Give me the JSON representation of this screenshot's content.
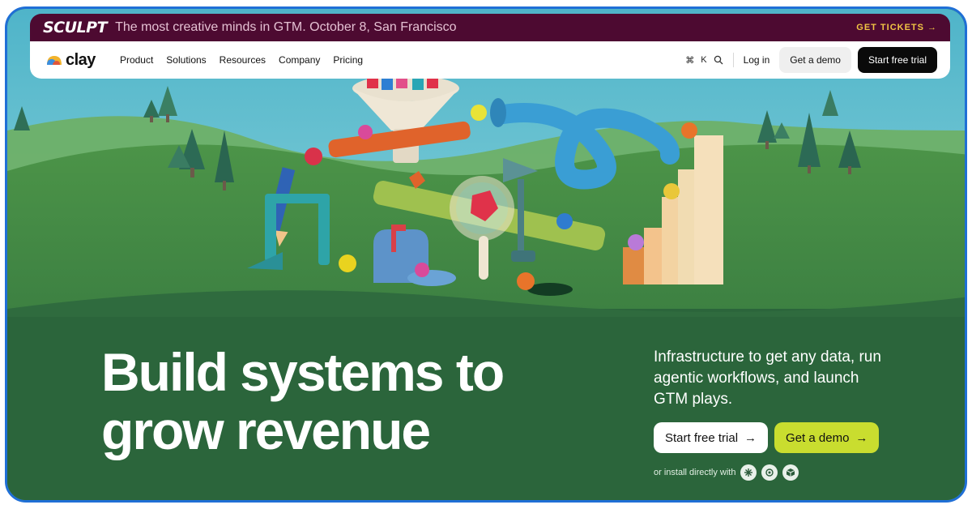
{
  "announcement": {
    "logo_text": "SCULPT",
    "text": "The most creative minds in GTM. October 8, San Francisco",
    "cta": "GET TICKETS",
    "cta_icon": "arrow-right-icon"
  },
  "nav": {
    "brand": "clay",
    "links": [
      "Product",
      "Solutions",
      "Resources",
      "Company",
      "Pricing"
    ],
    "shortcut_cmd": "⌘",
    "shortcut_key": "K",
    "search_icon": "search-icon",
    "login": "Log in",
    "demo": "Get a demo",
    "trial": "Start free trial"
  },
  "hero": {
    "headline_line1": "Build systems to",
    "headline_line2": "grow revenue",
    "subcopy": "Infrastructure to get any data, run agentic workflows, and launch GTM plays.",
    "trial_button": "Start free trial",
    "demo_button": "Get a demo",
    "install_text": "or install directly with",
    "install_icons": [
      "asterisk-icon",
      "openai-icon",
      "cube-icon"
    ]
  },
  "colors": {
    "announce_bg": "#4d0a31",
    "accent_yellow": "#f1c544",
    "demo_green": "#c9dd2f",
    "frame_blue": "#1f6fd6",
    "hero_green": "#2f6a3c"
  }
}
